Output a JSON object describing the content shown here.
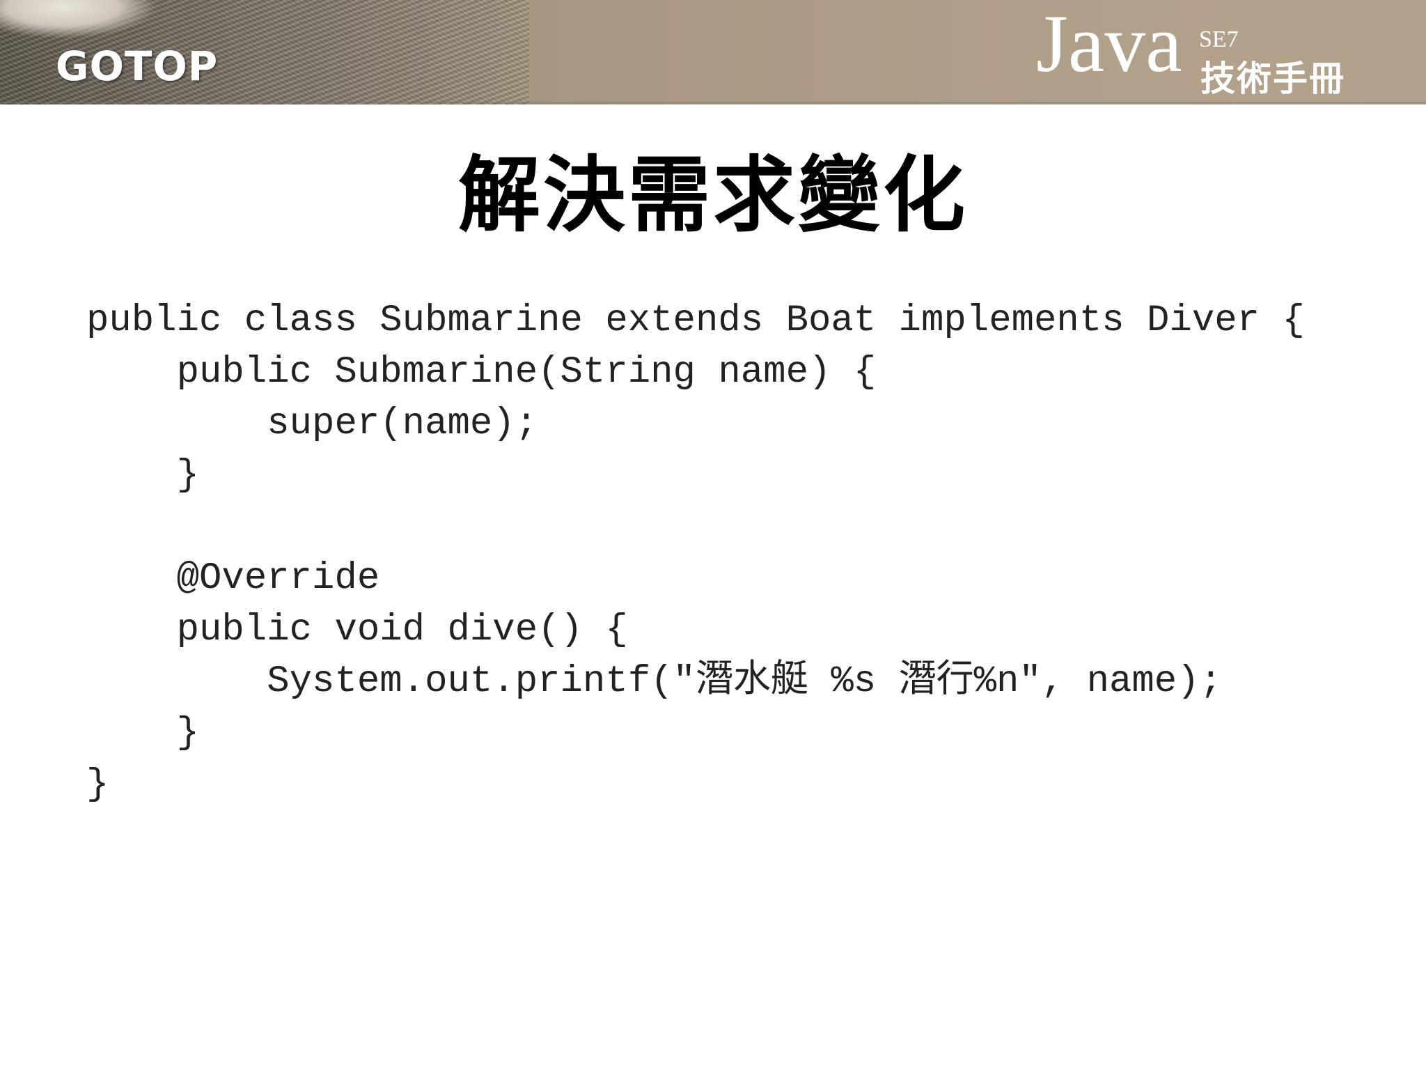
{
  "header": {
    "logo_text": "GOTOP",
    "brand_java": "Java",
    "brand_version": "SE7",
    "brand_subtitle": "技術手冊"
  },
  "slide": {
    "title": "解決需求變化",
    "code_lines": [
      "public class Submarine extends Boat implements Diver {",
      "    public Submarine(String name) {",
      "        super(name);",
      "    }",
      "",
      "    @Override",
      "    public void dive() {",
      "        System.out.printf(\"潛水艇 %s 潛行%n\", name);",
      "    }",
      "}"
    ]
  }
}
